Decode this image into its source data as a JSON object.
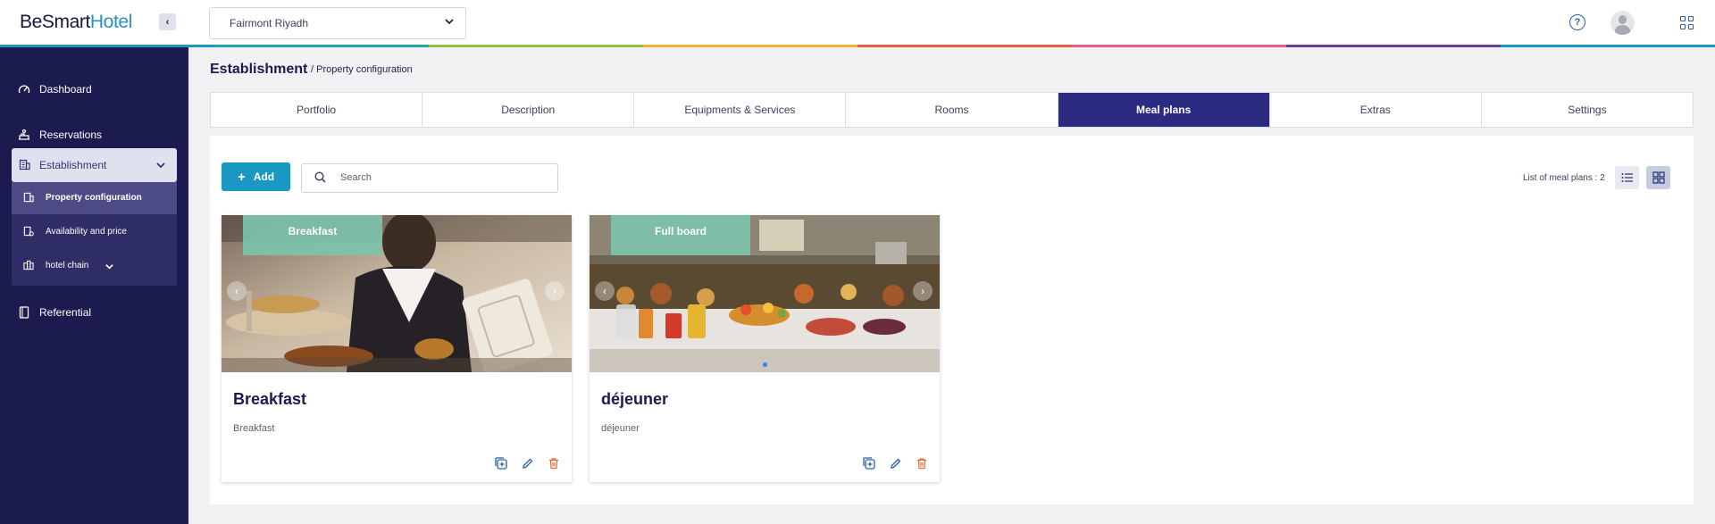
{
  "app": {
    "logo_main": "BeSmart",
    "logo_accent": "Hotel"
  },
  "header": {
    "hotel_selected": "Fairmont Riyadh"
  },
  "sidebar": {
    "dashboard": "Dashboard",
    "reservations": "Reservations",
    "establishment": "Establishment",
    "sub_items": [
      "Property configuration",
      "Availability and price",
      "hotel chain"
    ],
    "referential": "Referential"
  },
  "page": {
    "title": "Establishment",
    "breadcrumb": "/ Property configuration"
  },
  "tabs": [
    "Portfolio",
    "Description",
    "Equipments & Services",
    "Rooms",
    "Meal plans",
    "Extras",
    "Settings"
  ],
  "active_tab": "Meal plans",
  "toolbar": {
    "add_label": "Add",
    "search_placeholder": "Search",
    "list_count": "List of meal plans : 2"
  },
  "cards": [
    {
      "tag": "Breakfast",
      "title": "Breakfast",
      "description": "Breakfast"
    },
    {
      "tag": "Full board",
      "title": "déjeuner",
      "description": "déjeuner"
    }
  ],
  "colors": {
    "sidebar_bg": "#1c1b4f",
    "active_tab": "#2b2b82",
    "add_button": "#1a98c1",
    "tag_bg": "#7cc4ac",
    "delete_icon": "#e3673a",
    "rainbow": [
      "#1a98c1",
      "#22a6b3",
      "#8bc34a",
      "#f2b233",
      "#e55d3c",
      "#e8608a",
      "#6a3d9a",
      "#1a98c1"
    ]
  }
}
